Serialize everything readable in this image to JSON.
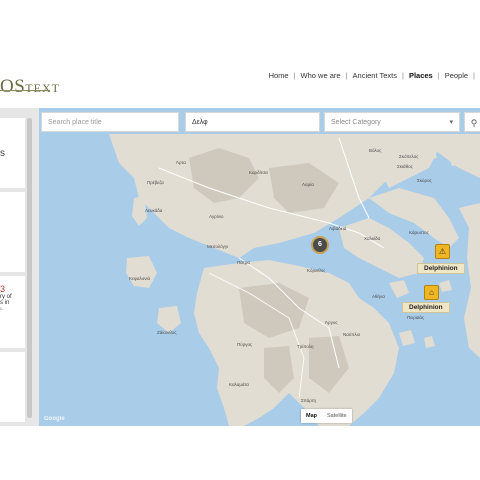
{
  "header": {
    "logo_big": "OS",
    "logo_small": "TEXT",
    "nav": [
      {
        "label": "Home",
        "active": false
      },
      {
        "label": "Who we are",
        "active": false
      },
      {
        "label": "Ancient Texts",
        "active": false
      },
      {
        "label": "Places",
        "active": true
      },
      {
        "label": "People",
        "active": false
      }
    ]
  },
  "search": {
    "title_placeholder": "Search place title",
    "place_value": "Δελφ",
    "category_placeholder": "Select Category",
    "search_icon": "search-icon"
  },
  "sidebar": {
    "card1_fragment": "s",
    "card2_number": "3",
    "card2_line1": "ry of",
    "card2_line2": "s in",
    "card2_tiny": "c."
  },
  "map": {
    "cluster_count": "6",
    "markers": [
      {
        "label": "Delphinion",
        "icon": "temple-warning-icon"
      },
      {
        "label": "Delphinion",
        "icon": "temple-icon"
      }
    ],
    "labels": {
      "arta": "Άρτα",
      "preveza": "Πρέβεζα",
      "lefkada": "Λευκάδα",
      "kefalonia": "Κεφαλονιά",
      "agrinio": "Αγρίνιο",
      "messolonghi": "Μεσολόγγι",
      "patras": "Πάτρα",
      "pyrgos": "Πύργος",
      "zakynthos": "Ζάκυνθος",
      "lamia": "Λαμία",
      "livadia": "Λιβαδειά",
      "chalkida": "Χαλκίδα",
      "corinth": "Κόρινθος",
      "athens": "Αθήνα",
      "piraeus": "Πειραιάς",
      "tripoli": "Τρίπολη",
      "kalamata": "Καλαμάτα",
      "sparti": "Σπάρτη",
      "volos": "Βόλος",
      "skopelos": "Σκόπελος",
      "skiathos": "Σκιάθος",
      "skyros": "Σκύρος",
      "karystos": "Κάρυστος",
      "argos": "Άργος",
      "nafplio": "Ναύπλιο",
      "karditsa": "Καρδίτσα"
    },
    "map_type": {
      "map": "Map",
      "satellite": "Satellite"
    },
    "attribution": "Google",
    "colors": {
      "sea": "#a9cce9",
      "land": "#e2ddd3",
      "mountain": "#cfc9bd",
      "marker": "#efb624",
      "cluster": "#4b4b4b"
    }
  }
}
